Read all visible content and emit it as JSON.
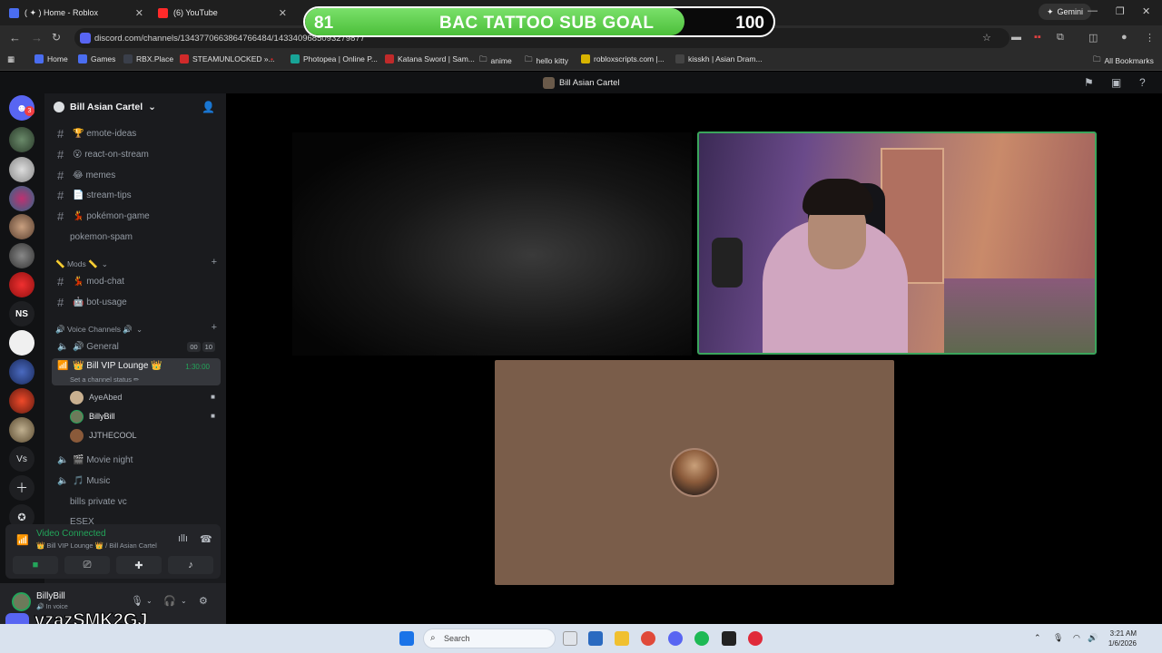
{
  "browser": {
    "tabs": [
      {
        "label": "( ✦ ) Home - Roblox"
      },
      {
        "label": "(6) YouTube"
      }
    ],
    "gemini_label": "Gemini",
    "url": "discord.com/channels/1343770663864766484/1433409685093279877",
    "bookmarks": [
      "Home",
      "Games",
      "RBX.Place",
      "STEAMUNLOCKED »...",
      "Photopea | Online P...",
      "Katana Sword | Sam...",
      "anime",
      "hello kitty",
      "robloxscripts.com |...",
      "kisskh | Asian Dram..."
    ],
    "all_bookmarks": "All Bookmarks"
  },
  "overlay": {
    "current": "81",
    "title": "BAC TATTOO SUB GOAL",
    "target": "100",
    "progress_fraction": 0.81
  },
  "discord": {
    "header_server": "Bill Asian Cartel",
    "server_name": "Bill Asian Cartel",
    "rail_badge": "3",
    "rail_ns": "NS",
    "rail_vs": "Vs",
    "channels": [
      {
        "prefix": "#",
        "label": "🏆 emote-ideas"
      },
      {
        "prefix": "#",
        "label": "😮 react-on-stream"
      },
      {
        "prefix": "#",
        "label": "😂 memes"
      },
      {
        "prefix": "#",
        "label": "📄 stream-tips"
      },
      {
        "prefix": "#",
        "label": "💃 pokémon-game"
      },
      {
        "prefix": "",
        "label": "pokemon-spam"
      }
    ],
    "mods_category": "📏 Mods 📏",
    "mod_channels": [
      {
        "prefix": "#",
        "label": "💃 mod-chat"
      },
      {
        "prefix": "#",
        "label": "🤖 bot-usage"
      }
    ],
    "voice_category": "🔊 Voice Channels 🔊",
    "voice_general": "🔊 General",
    "voice_general_pill_a": "00",
    "voice_general_pill_b": "10",
    "vip_lounge": "👑 Bill VIP Lounge 👑",
    "vip_timer": "1:30:00",
    "vip_status": "Set a channel status ✏",
    "members": [
      "AyeAbed",
      "BillyBill",
      "JJTHECOOL"
    ],
    "more_voice": [
      "🎬 Movie night",
      "🎵 Music",
      "bills private vc",
      "ESEX"
    ],
    "vc_title": "Video Connected",
    "vc_sub": "👑 Bill VIP Lounge 👑 / Bill Asian Cartel",
    "user_name": "BillyBill",
    "user_status": "🔊 In voice"
  },
  "watermark": "vzazSMK2GJ",
  "taskbar": {
    "search_placeholder": "Search",
    "time": "3:21 AM",
    "date": "1/6/2026"
  },
  "colors": {
    "discord_green": "#23a55a",
    "goal_fill": "#5fd04e",
    "blurple": "#5865f2"
  }
}
